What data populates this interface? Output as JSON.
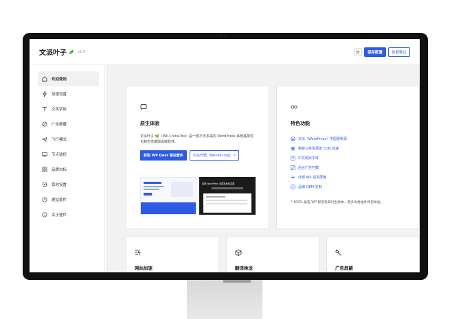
{
  "app": {
    "name": "文派叶子",
    "version": "v1.0"
  },
  "toolbar": {
    "save_label": "保存配置",
    "reset_label": "恢复默认"
  },
  "sidebar": {
    "items": [
      {
        "label": "欢迎使用",
        "icon": "home-icon",
        "active": true
      },
      {
        "label": "加速设置",
        "icon": "bolt-icon"
      },
      {
        "label": "文风字体",
        "icon": "font-icon"
      },
      {
        "label": "广告屏蔽",
        "icon": "block-icon"
      },
      {
        "label": "飞行模式",
        "icon": "plane-icon"
      },
      {
        "label": "节点监控",
        "icon": "monitor-icon"
      },
      {
        "label": "品牌白标",
        "icon": "grid-icon"
      },
      {
        "label": "其他设置",
        "icon": "settings-icon"
      },
      {
        "label": "建站套件",
        "icon": "clock-icon"
      },
      {
        "label": "关于插件",
        "icon": "info-icon"
      }
    ]
  },
  "native_card": {
    "title": "原生体验",
    "desc": "文派叶子 🌿（WP-China-Yes）是一款不可多得的 WordPress 系统底层优化和生态基础设施软件。",
    "primary_button": "获取 WP Deer 建站套件",
    "secondary_button": "文派开源（WenPai.org）↗",
    "thumb_dark_text": "将是 WordPress 中国本地化发展"
  },
  "features_card": {
    "title": "特色功能",
    "items": [
      {
        "label": "文派（WordPress）中国更新源",
        "icon": "wp-icon"
      },
      {
        "label": "萌芽公共资源库 CDN 加速",
        "icon": "cloud-icon"
      },
      {
        "label": "中文网页字体",
        "icon": "font-icon"
      },
      {
        "label": "后台广告拦截",
        "icon": "ad-block-icon"
      },
      {
        "label": "外部 API 请求屏蔽",
        "icon": "api-icon"
      },
      {
        "label": "品牌 OEM 定制",
        "icon": "brand-icon"
      }
    ],
    "note": "* 100% 兼容 WP 程序及其衍生版本，更多优秀插件待您体验。"
  },
  "bottom_cards": [
    {
      "title": "网站加速",
      "icon": "speed-icon"
    },
    {
      "title": "翻译推送",
      "icon": "package-icon"
    },
    {
      "title": "广告屏蔽",
      "icon": "brush-icon"
    }
  ],
  "colors": {
    "accent": "#2d5be3",
    "bg": "#f2f2f2"
  }
}
